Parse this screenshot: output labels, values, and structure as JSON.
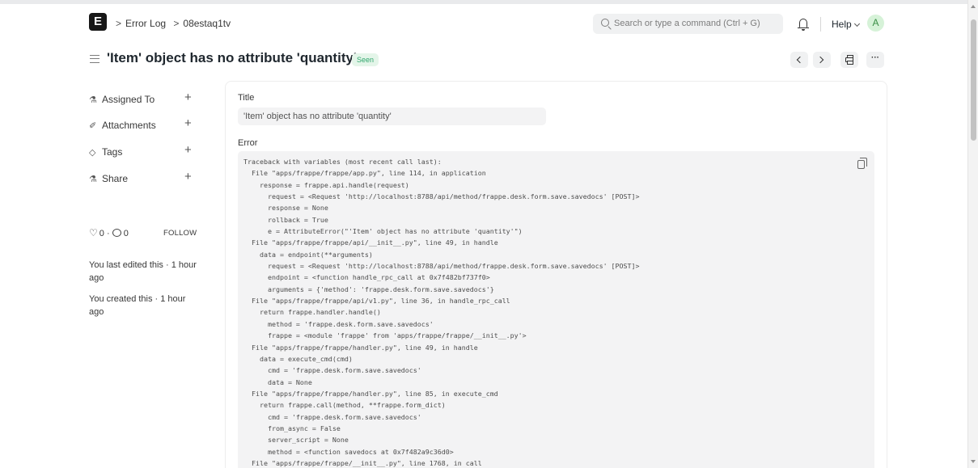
{
  "navbar": {
    "logo_letter": "E",
    "breadcrumbs": [
      "Error Log",
      "08estaq1tv"
    ],
    "search_placeholder": "Search or type a command (Ctrl + G)",
    "help_label": "Help",
    "avatar_initial": "A"
  },
  "page": {
    "title": "'Item' object has no attribute 'quantity'",
    "status_badge": "Seen"
  },
  "sidebar": {
    "items": [
      {
        "label": "Assigned To",
        "icon": "assign-icon"
      },
      {
        "label": "Attachments",
        "icon": "paperclip-icon"
      },
      {
        "label": "Tags",
        "icon": "tag-icon"
      },
      {
        "label": "Share",
        "icon": "share-icon"
      }
    ],
    "likes_count": "0",
    "comments_count": "0",
    "follow_label": "FOLLOW",
    "last_edited": "You last edited this · 1 hour ago",
    "created": "You created this · 1 hour ago"
  },
  "form": {
    "title_label": "Title",
    "title_value": "'Item' object has no attribute 'quantity'",
    "error_label": "Error",
    "error_traceback": "Traceback with variables (most recent call last):\n  File \"apps/frappe/frappe/app.py\", line 114, in application\n    response = frappe.api.handle(request)\n      request = <Request 'http://localhost:8788/api/method/frappe.desk.form.save.savedocs' [POST]>\n      response = None\n      rollback = True\n      e = AttributeError(\"'Item' object has no attribute 'quantity'\")\n  File \"apps/frappe/frappe/api/__init__.py\", line 49, in handle\n    data = endpoint(**arguments)\n      request = <Request 'http://localhost:8788/api/method/frappe.desk.form.save.savedocs' [POST]>\n      endpoint = <function handle_rpc_call at 0x7f482bf737f0>\n      arguments = {'method': 'frappe.desk.form.save.savedocs'}\n  File \"apps/frappe/frappe/api/v1.py\", line 36, in handle_rpc_call\n    return frappe.handler.handle()\n      method = 'frappe.desk.form.save.savedocs'\n      frappe = <module 'frappe' from 'apps/frappe/frappe/__init__.py'>\n  File \"apps/frappe/frappe/handler.py\", line 49, in handle\n    data = execute_cmd(cmd)\n      cmd = 'frappe.desk.form.save.savedocs'\n      data = None\n  File \"apps/frappe/frappe/handler.py\", line 85, in execute_cmd\n    return frappe.call(method, **frappe.form_dict)\n      cmd = 'frappe.desk.form.save.savedocs'\n      from_async = False\n      server_script = None\n      method = <function savedocs at 0x7f482a9c36d0>\n  File \"apps/frappe/frappe/__init__.py\", line 1768, in call"
  },
  "colors": {
    "badge_bg": "#e4f5e9",
    "badge_text": "#30a66d",
    "avatar_bg": "#d6f2d8",
    "field_bg": "#f3f3f4"
  }
}
